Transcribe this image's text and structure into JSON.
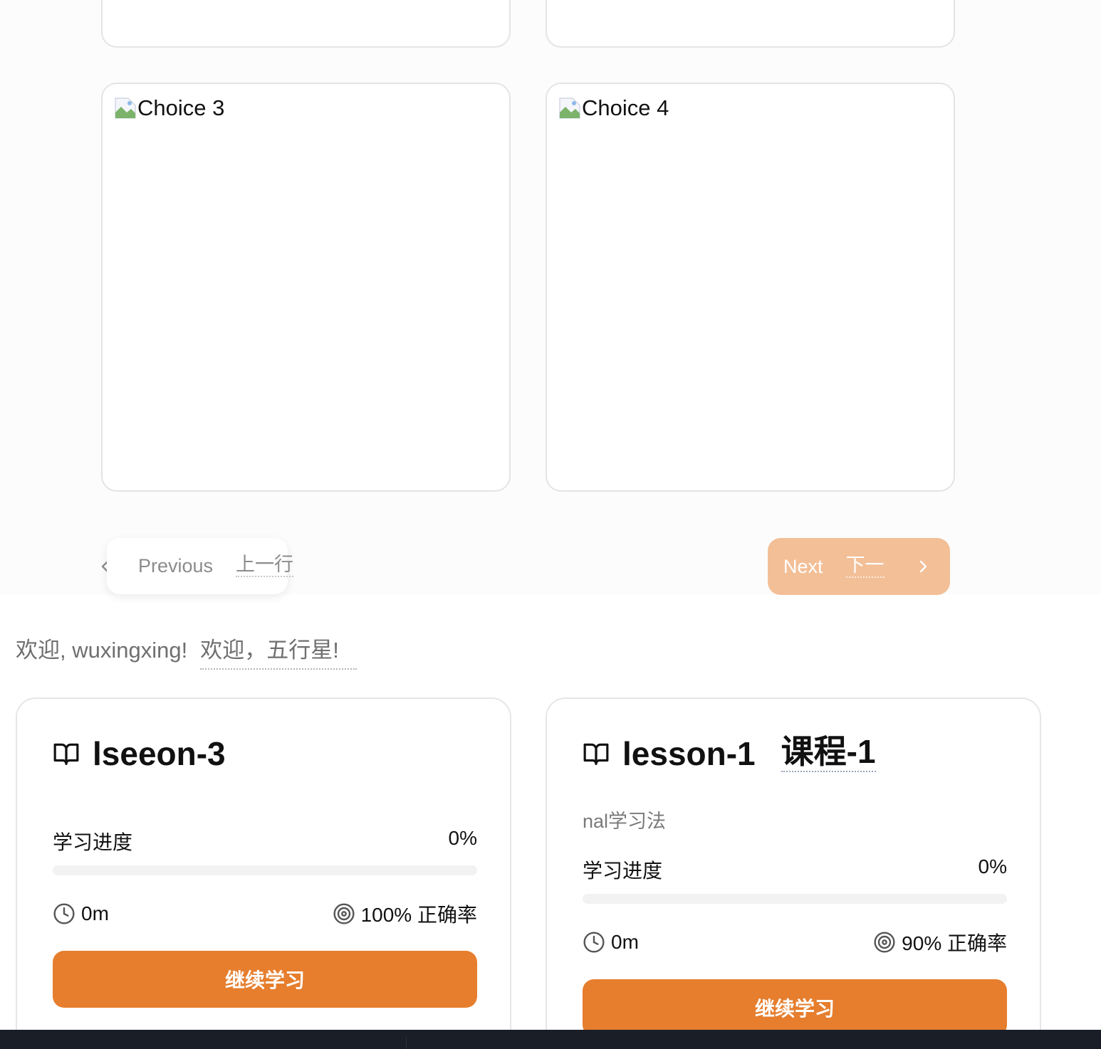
{
  "quiz": {
    "choices": [
      {
        "label": "Choice 3"
      },
      {
        "label": "Choice 4"
      }
    ],
    "prev_button": {
      "label": "Previous",
      "label_cn": "上一行"
    },
    "next_button": {
      "label": "Next",
      "label_cn": "下一"
    }
  },
  "welcome": {
    "text": "欢迎, wuxingxing!",
    "text_cn": "欢迎，五行星!"
  },
  "lessons": [
    {
      "title": "lseeon-3",
      "title_cn": "",
      "subtitle": "",
      "progress_label": "学习进度",
      "progress_text": "0%",
      "progress_value": 0,
      "time": "0m",
      "accuracy": "100% 正确率",
      "button": "继续学习"
    },
    {
      "title": "lesson-1",
      "title_cn": "课程-1",
      "subtitle": "nal学习法",
      "progress_label": "学习进度",
      "progress_text": "0%",
      "progress_value": 0,
      "time": "0m",
      "accuracy": "90% 正确率",
      "button": "继续学习"
    }
  ],
  "colors": {
    "accent": "#e67e2e",
    "next_button_disabled": "#f3bf97",
    "card_border": "#e4e4e4",
    "bottom_bar": "#1a1e27"
  },
  "icons": [
    "broken-image-icon",
    "chevron-left-icon",
    "chevron-right-icon",
    "book-open-icon",
    "clock-icon",
    "target-icon"
  ]
}
